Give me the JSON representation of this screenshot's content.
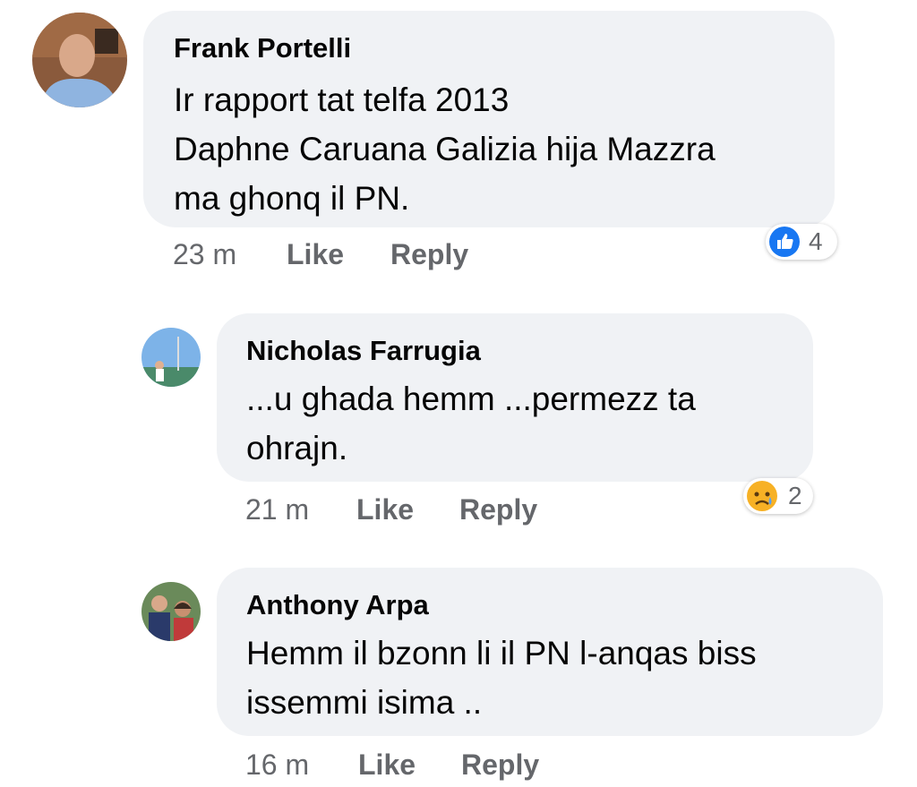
{
  "comments": [
    {
      "author": "Frank Portelli",
      "lines": [
        "Ir rapport tat telfa 2013",
        "Daphne Caruana Galizia hija Mazzra",
        "ma ghonq il PN."
      ],
      "time": "23 m",
      "like_label": "Like",
      "reply_label": "Reply",
      "reaction_icon": "like-icon",
      "reaction_count": "4"
    },
    {
      "author": "Nicholas Farrugia",
      "lines": [
        "...u ghada hemm ...permezz ta",
        "ohrajn."
      ],
      "time": "21 m",
      "like_label": "Like",
      "reply_label": "Reply",
      "reaction_icon": "sad-icon",
      "reaction_count": "2"
    },
    {
      "author": "Anthony Arpa",
      "lines": [
        "Hemm il bzonn li il PN l-anqas biss",
        "issemmi isima .."
      ],
      "time": "16 m",
      "like_label": "Like",
      "reply_label": "Reply"
    }
  ],
  "colors": {
    "bubble": "#f0f2f5",
    "like_blue": "#1877f2",
    "meta_gray": "#65676b",
    "sad_yellow": "#f7b125"
  }
}
